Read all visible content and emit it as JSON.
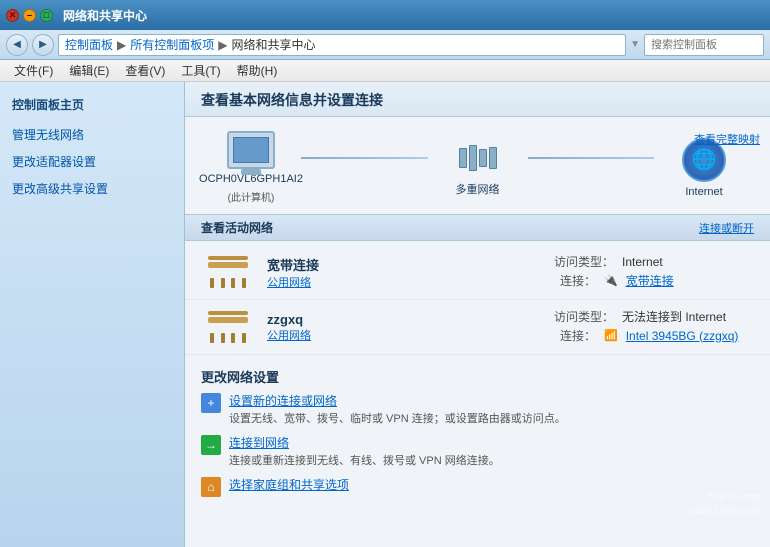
{
  "titlebar": {
    "title": "网络和共享中心"
  },
  "addressbar": {
    "back_label": "◀",
    "forward_label": "▶",
    "crumb1": "控制面板",
    "sep1": "▶",
    "crumb2": "所有控制面板项",
    "sep2": "▶",
    "crumb3": "网络和共享中心",
    "dropdown_label": "▼",
    "search_placeholder": "搜索控制面板"
  },
  "menubar": {
    "file": "文件(F)",
    "edit": "编辑(E)",
    "view": "查看(V)",
    "tools": "工具(T)",
    "help": "帮助(H)"
  },
  "sidebar": {
    "title": "控制面板主页",
    "links": [
      "管理无线网络",
      "更改适配器设置",
      "更改高级共享设置"
    ]
  },
  "content": {
    "header_title": "查看基本网络信息并设置连接",
    "view_complete_label": "查看完整映射",
    "network_diagram": {
      "computer_label": "OCPH0VL6GPH1AI2",
      "computer_sublabel": "(此计算机)",
      "multi_label": "多重网络",
      "internet_label": "Internet"
    },
    "active_section": "查看活动网络",
    "connect_or_disconnect": "连接或断开",
    "networks": [
      {
        "name": "宽带连接",
        "type": "公用网络",
        "access_label": "访问类型：",
        "access_value": "Internet",
        "connect_label": "连接：",
        "connect_icon": "🔌",
        "connect_value": "宽带连接"
      },
      {
        "name": "zzgxq",
        "type": "公用网络",
        "access_label": "访问类型：",
        "access_value": "无法连接到 Internet",
        "connect_label": "连接：",
        "connect_icon": "📶",
        "connect_value": "Intel 3945BG (zzgxq)"
      }
    ],
    "change_settings_title": "更改网络设置",
    "settings_items": [
      {
        "link": "设置新的连接或网络",
        "desc": "设置无线、宽带、拨号、临时或 VPN 连接；或设置路由器或访问点。",
        "icon": "+"
      },
      {
        "link": "连接到网络",
        "desc": "连接或重新连接到无线、有线、拨号或 VPN 网络连接。",
        "icon": "→"
      },
      {
        "link": "选择家庭组和共享选项",
        "desc": "",
        "icon": "⌂"
      }
    ]
  },
  "watermark": {
    "line1": "51CTO.com",
    "line2": "www.zzgxq.com"
  }
}
